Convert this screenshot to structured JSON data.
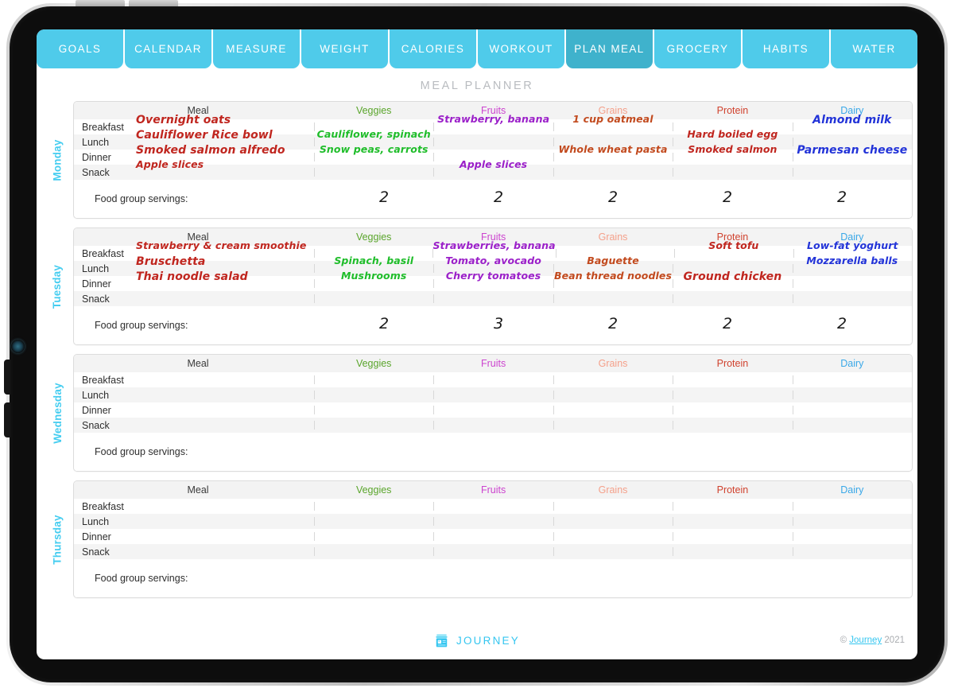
{
  "tabs": [
    {
      "label": "GOALS",
      "active": false
    },
    {
      "label": "CALENDAR",
      "active": false
    },
    {
      "label": "MEASURE",
      "active": false
    },
    {
      "label": "WEIGHT",
      "active": false
    },
    {
      "label": "CALORIES",
      "active": false
    },
    {
      "label": "WORKOUT",
      "active": false
    },
    {
      "label": "PLAN MEAL",
      "active": true
    },
    {
      "label": "GROCERY",
      "active": false
    },
    {
      "label": "HABITS",
      "active": false
    },
    {
      "label": "WATER",
      "active": false
    }
  ],
  "page": {
    "title": "MEAL PLANNER"
  },
  "columns": {
    "meal": "Meal",
    "veggies": "Veggies",
    "fruits": "Fruits",
    "grains": "Grains",
    "protein": "Protein",
    "dairy": "Dairy"
  },
  "meal_rows": [
    "Breakfast",
    "Lunch",
    "Dinner",
    "Snack"
  ],
  "servings_label": "Food group servings:",
  "colors": {
    "tab": "#4fcbea",
    "tab_active": "#3fb2cc",
    "veggies": "#5aa52b",
    "fruits": "#cc44cf",
    "grains": "#f4a08a",
    "protein": "#d0422e",
    "dairy": "#3aa8e8",
    "day_label": "#45cdf0",
    "ink_red": "#c0261f",
    "ink_green": "#1fbd2a",
    "ink_purple": "#9b20c9",
    "ink_orange": "#c24a1e",
    "ink_blue": "#2233d8"
  },
  "days": [
    {
      "name": "Monday",
      "meals": {
        "breakfast": "Overnight oats",
        "lunch": "Cauliflower Rice bowl",
        "dinner": "Smoked salmon alfredo",
        "snack": "Apple slices"
      },
      "veggies": {
        "lunch": "Cauliflower, spinach",
        "dinner": "Snow peas, carrots"
      },
      "fruits": {
        "breakfast": "Strawberry, banana",
        "snack": "Apple slices"
      },
      "grains": {
        "breakfast": "1 cup oatmeal",
        "dinner": "Whole wheat pasta"
      },
      "protein": {
        "lunch": "Hard boiled egg",
        "dinner": "Smoked salmon"
      },
      "dairy": {
        "breakfast": "Almond milk",
        "dinner": "Parmesan cheese"
      },
      "servings": {
        "veggies": "2",
        "fruits": "2",
        "grains": "2",
        "protein": "2",
        "dairy": "2"
      }
    },
    {
      "name": "Tuesday",
      "meals": {
        "breakfast": "Strawberry & cream smoothie",
        "lunch": "Bruschetta",
        "dinner": "Thai noodle salad",
        "snack": ""
      },
      "veggies": {
        "lunch": "Spinach, basil",
        "dinner": "Mushrooms"
      },
      "fruits": {
        "breakfast": "Strawberries, banana",
        "lunch": "Tomato, avocado",
        "dinner": "Cherry tomatoes"
      },
      "grains": {
        "lunch": "Baguette",
        "dinner": "Bean thread noodles"
      },
      "protein": {
        "breakfast": "Soft tofu",
        "dinner": "Ground chicken"
      },
      "dairy": {
        "breakfast": "Low-fat yoghurt",
        "lunch": "Mozzarella balls"
      },
      "servings": {
        "veggies": "2",
        "fruits": "3",
        "grains": "2",
        "protein": "2",
        "dairy": "2"
      }
    },
    {
      "name": "Wednesday",
      "meals": {
        "breakfast": "",
        "lunch": "",
        "dinner": "",
        "snack": ""
      },
      "veggies": {},
      "fruits": {},
      "grains": {},
      "protein": {},
      "dairy": {},
      "servings": {
        "veggies": "",
        "fruits": "",
        "grains": "",
        "protein": "",
        "dairy": ""
      }
    },
    {
      "name": "Thursday",
      "meals": {
        "breakfast": "",
        "lunch": "",
        "dinner": "",
        "snack": ""
      },
      "veggies": {},
      "fruits": {},
      "grains": {},
      "protein": {},
      "dairy": {},
      "servings": {
        "veggies": "",
        "fruits": "",
        "grains": "",
        "protein": "",
        "dairy": ""
      }
    }
  ],
  "footer": {
    "brand": "JOURNEY",
    "copyright_symbol": "©",
    "copyright_link": "Journey",
    "copyright_year": "2021"
  }
}
